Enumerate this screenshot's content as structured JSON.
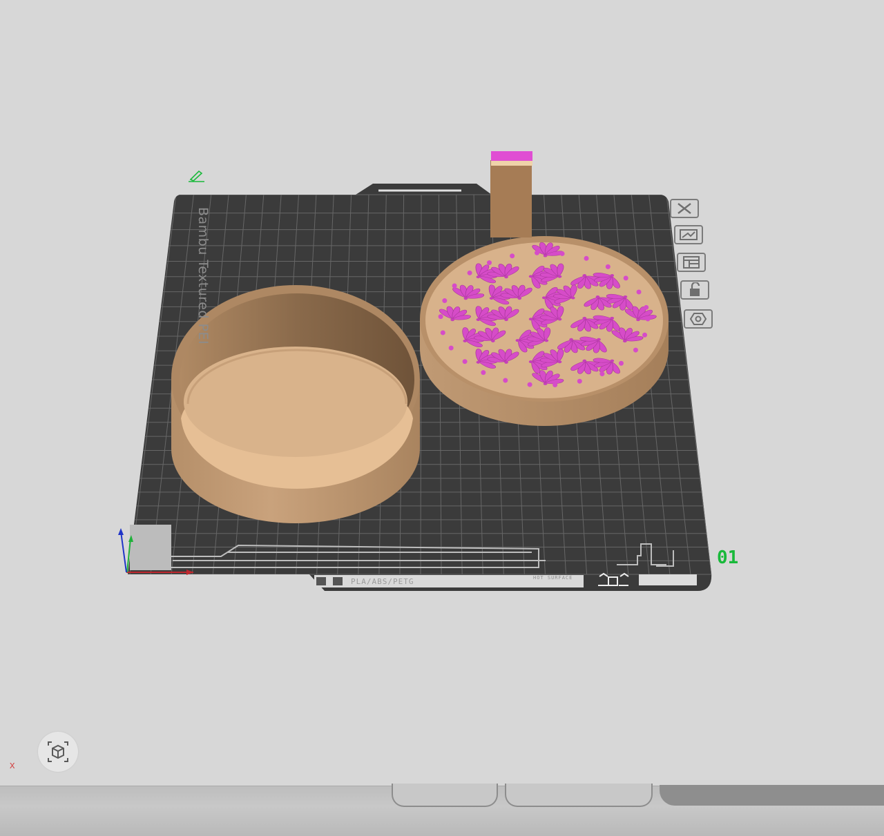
{
  "plate": {
    "name": "Bambu Textured PEI",
    "number": "01",
    "filament_types": "PLA/ABS/PETG",
    "surface_warning": "HOT SURFACE"
  },
  "objects": [
    {
      "name": "round box base",
      "color": "#c9a27c"
    },
    {
      "name": "patterned lid",
      "color": "#c9a27c",
      "pattern_color": "#e04ed3"
    },
    {
      "name": "prime tower",
      "color": "#a67c55",
      "top_color": "#e04ed3"
    }
  ],
  "plate_toolbar": {
    "items": [
      "close-icon",
      "auto-arrange-icon",
      "layout-icon",
      "lock-icon",
      "settings-icon"
    ]
  },
  "viewport": {
    "close_mark": "x"
  },
  "colors": {
    "background": "#d7d7d7",
    "plate": "#3c3c3c",
    "grid": "#6a6a6a",
    "accent_green": "#19b93a",
    "filament_magenta": "#e04ed3",
    "filament_tan": "#c9a27c"
  }
}
